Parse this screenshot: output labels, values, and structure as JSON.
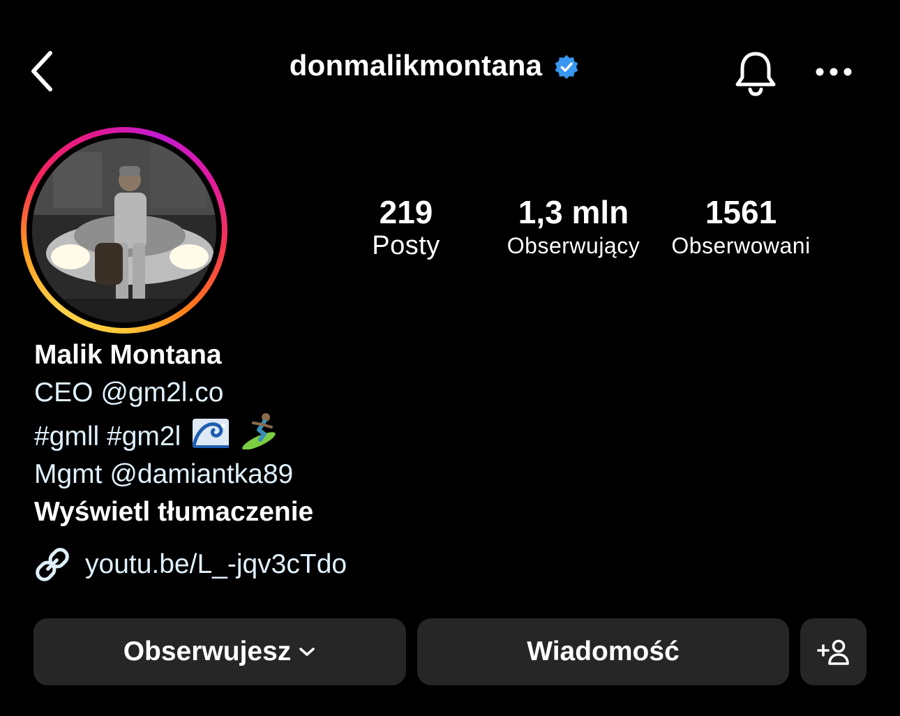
{
  "header": {
    "username": "donmalikmontana",
    "verified": true,
    "back_icon": "chevron-left-icon",
    "bell_icon": "bell-icon",
    "more_icon": "more-horizontal-icon"
  },
  "stats": {
    "posts": {
      "value": "219",
      "label": "Posty"
    },
    "followers": {
      "value": "1,3 mln",
      "label": "Obserwujący"
    },
    "following": {
      "value": "1561",
      "label": "Obserwowani"
    }
  },
  "bio": {
    "name": "Malik Montana",
    "line1": "CEO @gm2l.co",
    "line2_text": "#gmll #gm2l",
    "line2_emojis": [
      "wave-emoji",
      "surfer-emoji"
    ],
    "line3": "Mgmt @damiantka89",
    "translate": "Wyświetl tłumaczenie",
    "link": "youtu.be/L_-jqv3cTdo"
  },
  "actions": {
    "follow_label": "Obserwujesz",
    "message_label": "Wiadomość",
    "add_icon": "add-person-icon"
  },
  "colors": {
    "background": "#000000",
    "button_bg": "#262626",
    "verified_blue": "#3897f0",
    "link_text": "#e0f1ff"
  }
}
